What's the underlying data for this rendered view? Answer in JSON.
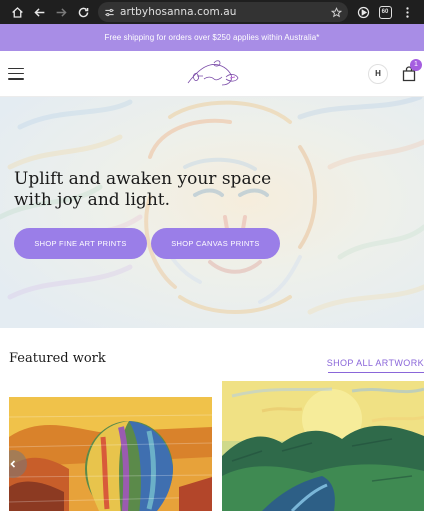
{
  "browser": {
    "url": "artbyhosanna.com.au",
    "tab_count": "60"
  },
  "promo": {
    "text": "Free shipping for orders over $250 applies within Australia*"
  },
  "header": {
    "logo_text": "Hosanna",
    "account_initial": "H",
    "cart_count": "1"
  },
  "hero": {
    "title": "Uplift and awaken your space with joy and light.",
    "buttons": [
      {
        "label": "SHOP FINE ART PRINTS"
      },
      {
        "label": "SHOP CANVAS PRINTS"
      }
    ]
  },
  "featured": {
    "title": "Featured work",
    "shop_all_label": "SHOP ALL ARTWORK"
  },
  "colors": {
    "accent": "#9a7ee8",
    "promo_bg": "#a88de6",
    "link": "#8a66d9",
    "badge": "#a55ee0"
  }
}
